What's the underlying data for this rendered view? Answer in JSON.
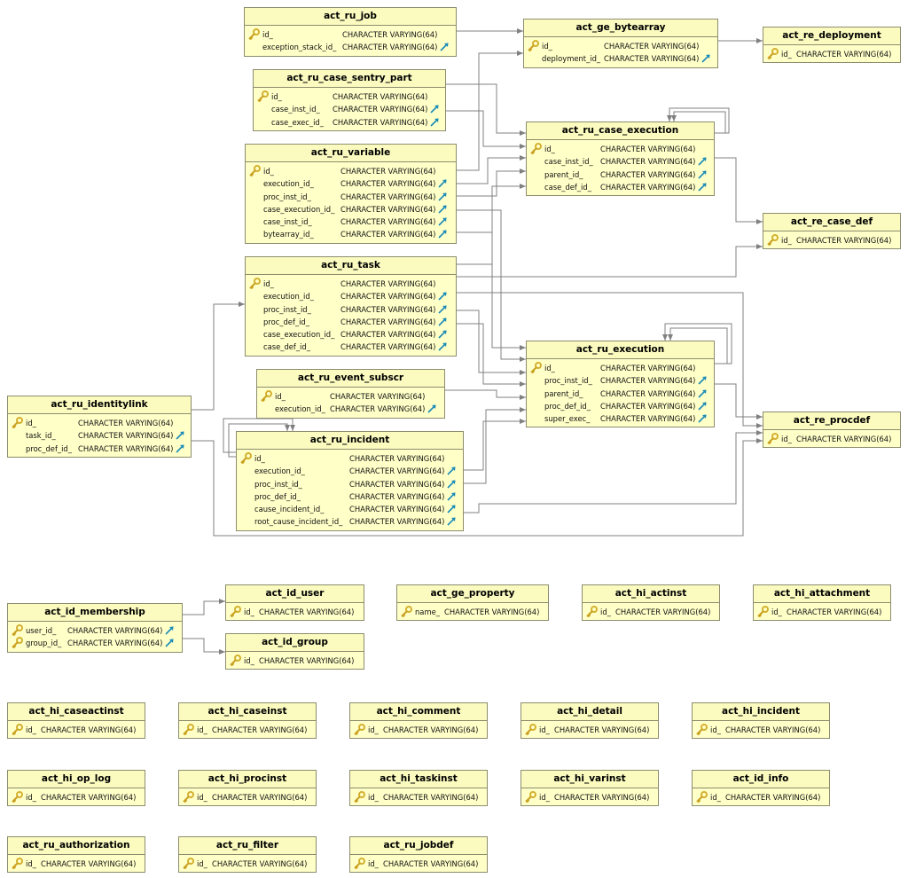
{
  "diagram": {
    "colors": {
      "table_fill": "#ffffc8",
      "border": "#8c8c6e",
      "line": "#808080",
      "pk_icon": "#d4b030",
      "fk_icon": "#1a8ab8"
    },
    "icons": {
      "primary_key": "key-icon",
      "foreign_key": "foreign-key-arrow-icon"
    },
    "tables": [
      {
        "name": "act_ru_job",
        "columns": [
          {
            "name": "id_",
            "type": "CHARACTER VARYING(64)",
            "pk": true
          },
          {
            "name": "exception_stack_id_",
            "type": "CHARACTER VARYING(64)",
            "fk": true
          }
        ]
      },
      {
        "name": "act_ge_bytearray",
        "columns": [
          {
            "name": "id_",
            "type": "CHARACTER VARYING(64)",
            "pk": true
          },
          {
            "name": "deployment_id_",
            "type": "CHARACTER VARYING(64)",
            "fk": true
          }
        ]
      },
      {
        "name": "act_re_deployment",
        "columns": [
          {
            "name": "id_",
            "type": "CHARACTER VARYING(64)",
            "pk": true
          }
        ]
      },
      {
        "name": "act_ru_case_sentry_part",
        "columns": [
          {
            "name": "id_",
            "type": "CHARACTER VARYING(64)",
            "pk": true
          },
          {
            "name": "case_inst_id_",
            "type": "CHARACTER VARYING(64)",
            "fk": true
          },
          {
            "name": "case_exec_id_",
            "type": "CHARACTER VARYING(64)",
            "fk": true
          }
        ]
      },
      {
        "name": "act_ru_case_execution",
        "columns": [
          {
            "name": "id_",
            "type": "CHARACTER VARYING(64)",
            "pk": true
          },
          {
            "name": "case_inst_id_",
            "type": "CHARACTER VARYING(64)",
            "fk": true
          },
          {
            "name": "parent_id_",
            "type": "CHARACTER VARYING(64)",
            "fk": true
          },
          {
            "name": "case_def_id_",
            "type": "CHARACTER VARYING(64)",
            "fk": true
          }
        ]
      },
      {
        "name": "act_ru_variable",
        "columns": [
          {
            "name": "id_",
            "type": "CHARACTER VARYING(64)",
            "pk": true
          },
          {
            "name": "execution_id_",
            "type": "CHARACTER VARYING(64)",
            "fk": true
          },
          {
            "name": "proc_inst_id_",
            "type": "CHARACTER VARYING(64)",
            "fk": true
          },
          {
            "name": "case_execution_id_",
            "type": "CHARACTER VARYING(64)",
            "fk": true
          },
          {
            "name": "case_inst_id_",
            "type": "CHARACTER VARYING(64)",
            "fk": true
          },
          {
            "name": "bytearray_id_",
            "type": "CHARACTER VARYING(64)",
            "fk": true
          }
        ]
      },
      {
        "name": "act_re_case_def",
        "columns": [
          {
            "name": "id_",
            "type": "CHARACTER VARYING(64)",
            "pk": true
          }
        ]
      },
      {
        "name": "act_ru_task",
        "columns": [
          {
            "name": "id_",
            "type": "CHARACTER VARYING(64)",
            "pk": true
          },
          {
            "name": "execution_id_",
            "type": "CHARACTER VARYING(64)",
            "fk": true
          },
          {
            "name": "proc_inst_id_",
            "type": "CHARACTER VARYING(64)",
            "fk": true
          },
          {
            "name": "proc_def_id_",
            "type": "CHARACTER VARYING(64)",
            "fk": true
          },
          {
            "name": "case_execution_id_",
            "type": "CHARACTER VARYING(64)",
            "fk": true
          },
          {
            "name": "case_def_id_",
            "type": "CHARACTER VARYING(64)",
            "fk": true
          }
        ]
      },
      {
        "name": "act_ru_execution",
        "columns": [
          {
            "name": "id_",
            "type": "CHARACTER VARYING(64)",
            "pk": true
          },
          {
            "name": "proc_inst_id_",
            "type": "CHARACTER VARYING(64)",
            "fk": true
          },
          {
            "name": "parent_id_",
            "type": "CHARACTER VARYING(64)",
            "fk": true
          },
          {
            "name": "proc_def_id_",
            "type": "CHARACTER VARYING(64)",
            "fk": true
          },
          {
            "name": "super_exec_",
            "type": "CHARACTER VARYING(64)",
            "fk": true
          }
        ]
      },
      {
        "name": "act_ru_event_subscr",
        "columns": [
          {
            "name": "id_",
            "type": "CHARACTER VARYING(64)",
            "pk": true
          },
          {
            "name": "execution_id_",
            "type": "CHARACTER VARYING(64)",
            "fk": true
          }
        ]
      },
      {
        "name": "act_ru_identitylink",
        "columns": [
          {
            "name": "id_",
            "type": "CHARACTER VARYING(64)",
            "pk": true
          },
          {
            "name": "task_id_",
            "type": "CHARACTER VARYING(64)",
            "fk": true
          },
          {
            "name": "proc_def_id_",
            "type": "CHARACTER VARYING(64)",
            "fk": true
          }
        ]
      },
      {
        "name": "act_re_procdef",
        "columns": [
          {
            "name": "id_",
            "type": "CHARACTER VARYING(64)",
            "pk": true
          }
        ]
      },
      {
        "name": "act_ru_incident",
        "columns": [
          {
            "name": "id_",
            "type": "CHARACTER VARYING(64)",
            "pk": true
          },
          {
            "name": "execution_id_",
            "type": "CHARACTER VARYING(64)",
            "fk": true
          },
          {
            "name": "proc_inst_id_",
            "type": "CHARACTER VARYING(64)",
            "fk": true
          },
          {
            "name": "proc_def_id_",
            "type": "CHARACTER VARYING(64)",
            "fk": true
          },
          {
            "name": "cause_incident_id_",
            "type": "CHARACTER VARYING(64)",
            "fk": true
          },
          {
            "name": "root_cause_incident_id_",
            "type": "CHARACTER VARYING(64)",
            "fk": true
          }
        ]
      },
      {
        "name": "act_id_user",
        "columns": [
          {
            "name": "id_",
            "type": "CHARACTER VARYING(64)",
            "pk": true
          }
        ]
      },
      {
        "name": "act_ge_property",
        "columns": [
          {
            "name": "name_",
            "type": "CHARACTER VARYING(64)",
            "pk": true
          }
        ]
      },
      {
        "name": "act_hi_actinst",
        "columns": [
          {
            "name": "id_",
            "type": "CHARACTER VARYING(64)",
            "pk": true
          }
        ]
      },
      {
        "name": "act_hi_attachment",
        "columns": [
          {
            "name": "id_",
            "type": "CHARACTER VARYING(64)",
            "pk": true
          }
        ]
      },
      {
        "name": "act_id_membership",
        "columns": [
          {
            "name": "user_id_",
            "type": "CHARACTER VARYING(64)",
            "pk": true,
            "fk": true
          },
          {
            "name": "group_id_",
            "type": "CHARACTER VARYING(64)",
            "pk": true,
            "fk": true
          }
        ]
      },
      {
        "name": "act_id_group",
        "columns": [
          {
            "name": "id_",
            "type": "CHARACTER VARYING(64)",
            "pk": true
          }
        ]
      },
      {
        "name": "act_hi_caseactinst",
        "columns": [
          {
            "name": "id_",
            "type": "CHARACTER VARYING(64)",
            "pk": true
          }
        ]
      },
      {
        "name": "act_hi_caseinst",
        "columns": [
          {
            "name": "id_",
            "type": "CHARACTER VARYING(64)",
            "pk": true
          }
        ]
      },
      {
        "name": "act_hi_comment",
        "columns": [
          {
            "name": "id_",
            "type": "CHARACTER VARYING(64)",
            "pk": true
          }
        ]
      },
      {
        "name": "act_hi_detail",
        "columns": [
          {
            "name": "id_",
            "type": "CHARACTER VARYING(64)",
            "pk": true
          }
        ]
      },
      {
        "name": "act_hi_incident",
        "columns": [
          {
            "name": "id_",
            "type": "CHARACTER VARYING(64)",
            "pk": true
          }
        ]
      },
      {
        "name": "act_hi_op_log",
        "columns": [
          {
            "name": "id_",
            "type": "CHARACTER VARYING(64)",
            "pk": true
          }
        ]
      },
      {
        "name": "act_hi_procinst",
        "columns": [
          {
            "name": "id_",
            "type": "CHARACTER VARYING(64)",
            "pk": true
          }
        ]
      },
      {
        "name": "act_hi_taskinst",
        "columns": [
          {
            "name": "id_",
            "type": "CHARACTER VARYING(64)",
            "pk": true
          }
        ]
      },
      {
        "name": "act_hi_varinst",
        "columns": [
          {
            "name": "id_",
            "type": "CHARACTER VARYING(64)",
            "pk": true
          }
        ]
      },
      {
        "name": "act_id_info",
        "columns": [
          {
            "name": "id_",
            "type": "CHARACTER VARYING(64)",
            "pk": true
          }
        ]
      },
      {
        "name": "act_ru_authorization",
        "columns": [
          {
            "name": "id_",
            "type": "CHARACTER VARYING(64)",
            "pk": true
          }
        ]
      },
      {
        "name": "act_ru_filter",
        "columns": [
          {
            "name": "id_",
            "type": "CHARACTER VARYING(64)",
            "pk": true
          }
        ]
      },
      {
        "name": "act_ru_jobdef",
        "columns": [
          {
            "name": "id_",
            "type": "CHARACTER VARYING(64)",
            "pk": true
          }
        ]
      }
    ]
  }
}
